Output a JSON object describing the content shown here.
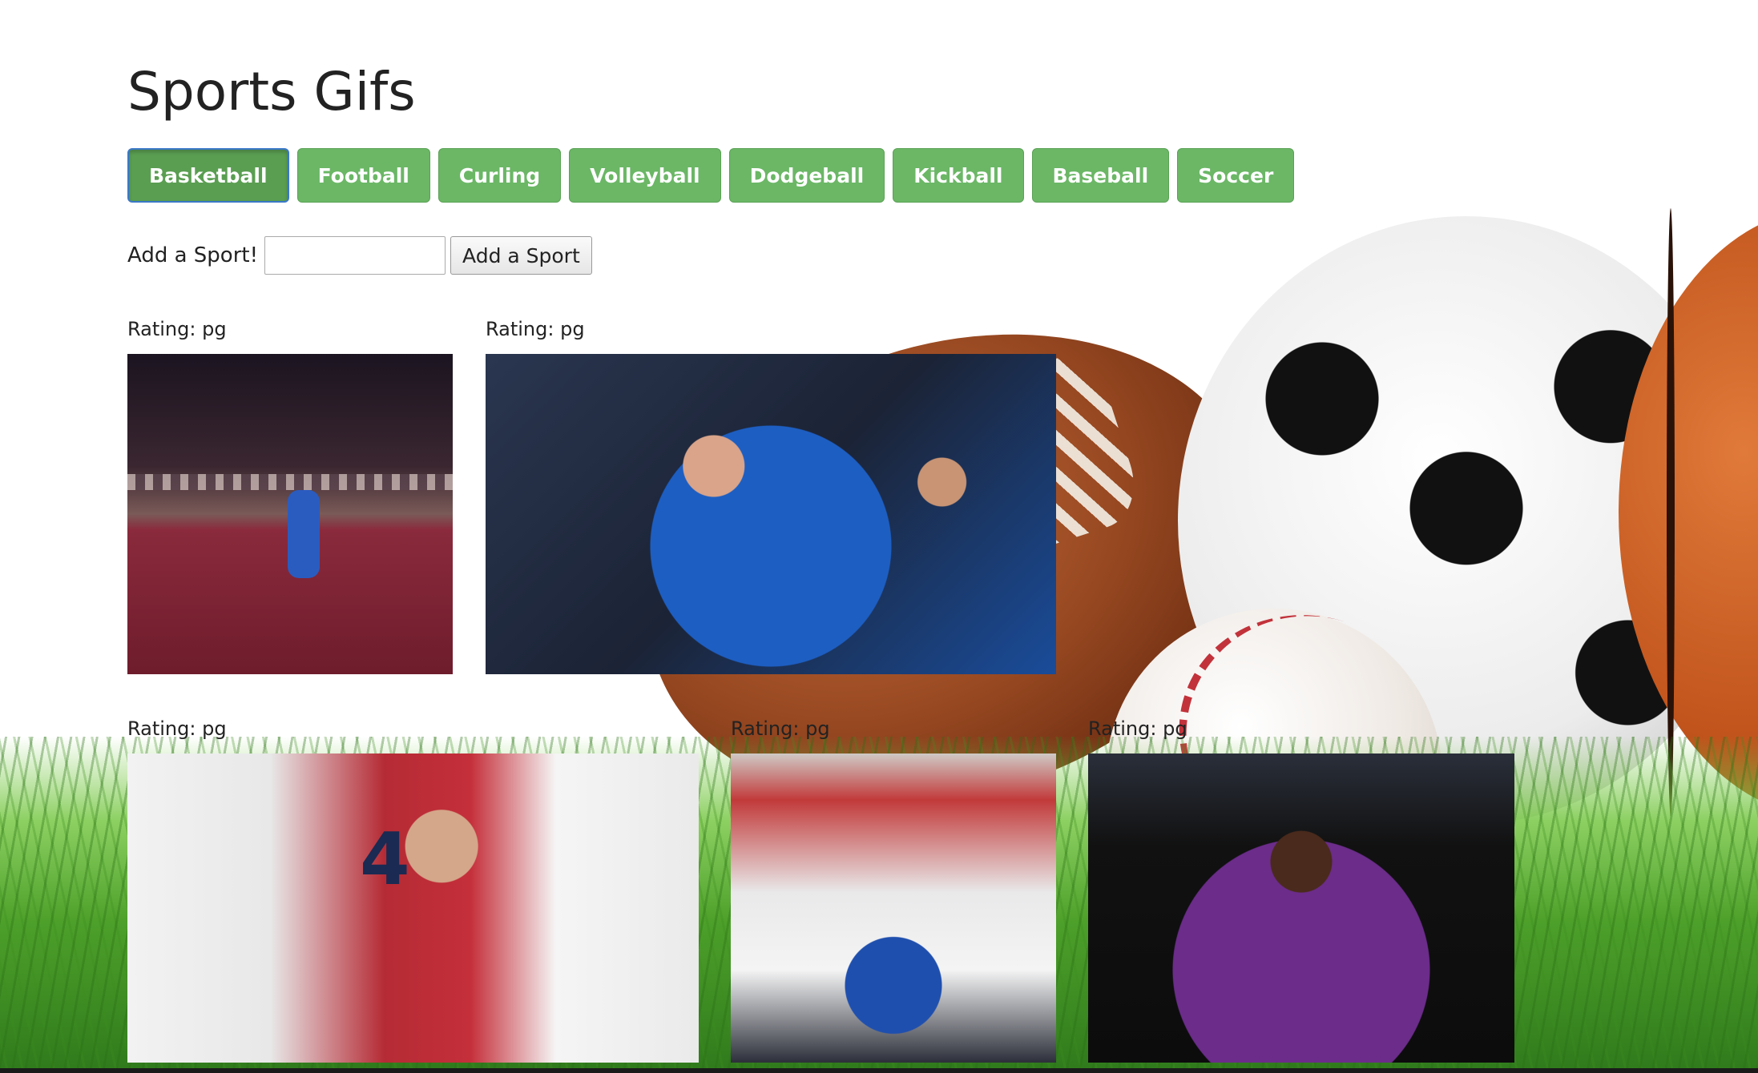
{
  "page": {
    "title": "Sports Gifs"
  },
  "sports": [
    {
      "label": "Basketball",
      "active": true
    },
    {
      "label": "Football",
      "active": false
    },
    {
      "label": "Curling",
      "active": false
    },
    {
      "label": "Volleyball",
      "active": false
    },
    {
      "label": "Dodgeball",
      "active": false
    },
    {
      "label": "Kickball",
      "active": false
    },
    {
      "label": "Baseball",
      "active": false
    },
    {
      "label": "Soccer",
      "active": false
    }
  ],
  "add_sport": {
    "label": "Add a Sport!",
    "input_value": "",
    "button_label": "Add a Sport"
  },
  "gifs": [
    {
      "rating": "Rating: pg",
      "icon": "basketball-court-gif"
    },
    {
      "rating": "Rating: pg",
      "icon": "warriors-fans-gif"
    },
    {
      "rating": "Rating: pg",
      "icon": "raptors-players-gif"
    },
    {
      "rating": "Rating: pg",
      "icon": "warriors-bench-gif"
    },
    {
      "rating": "Rating: pg",
      "icon": "costume-dunk-gif"
    }
  ],
  "colors": {
    "button_bg": "#6bb766",
    "button_active_bg": "#5a9e52",
    "button_text": "#ffffff",
    "text": "#222222"
  }
}
